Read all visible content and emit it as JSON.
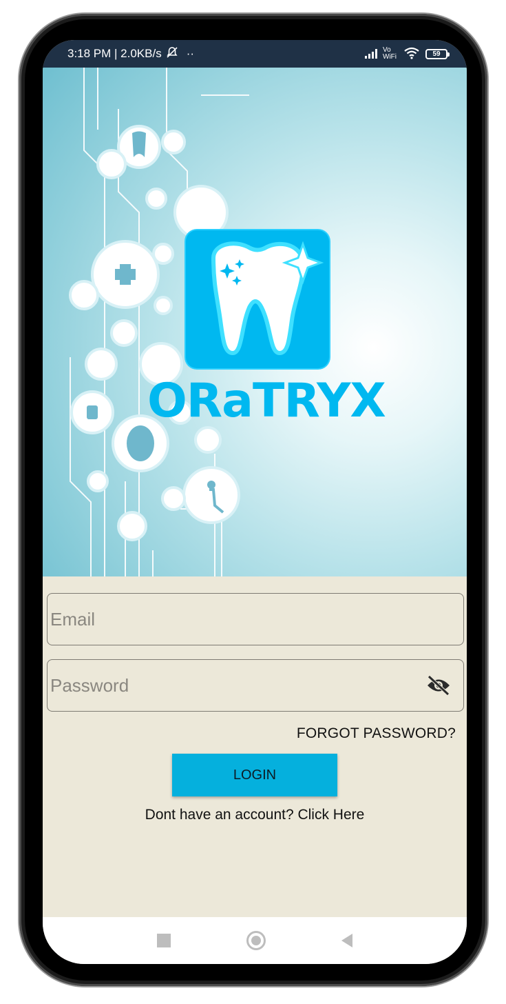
{
  "status_bar": {
    "time_speed": "3:18 PM | 2.0KB/s",
    "dots": "··",
    "vowifi": "Vo WiFi",
    "battery": "59"
  },
  "brand": {
    "name": "ORaTRYX",
    "accent_color": "#00b8f0"
  },
  "form": {
    "email_placeholder": "Email",
    "password_placeholder": "Password",
    "forgot_label": "FORGOT PASSWORD?",
    "login_label": "LOGIN",
    "signup_text": "Dont have an account? Click Here"
  },
  "icons": {
    "visibility_toggle": "eye-off-icon",
    "nav_recents": "square-icon",
    "nav_home": "circle-icon",
    "nav_back": "triangle-back-icon"
  }
}
